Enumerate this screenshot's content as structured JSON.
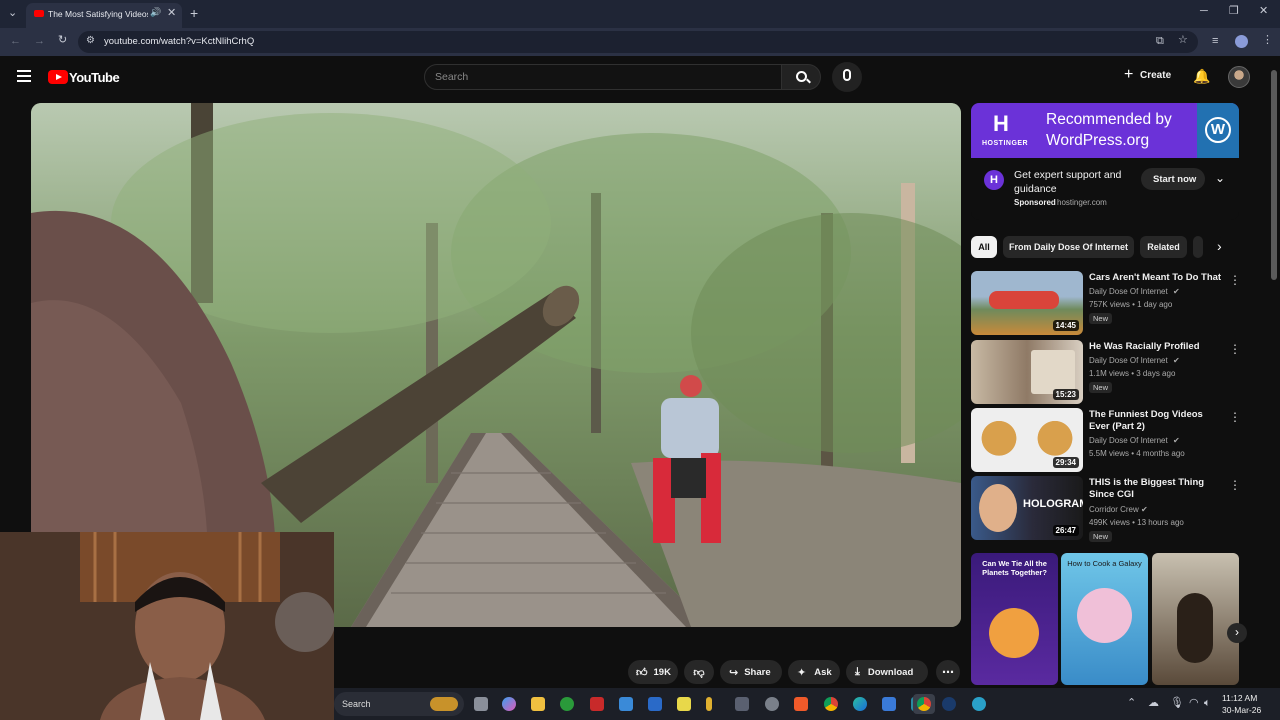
{
  "browser": {
    "tab_title": "The Most Satisfying Videos",
    "url": "youtube.com/watch?v=KctNlihCrhQ"
  },
  "youtube": {
    "logo_text": "YouTube",
    "search_placeholder": "Search",
    "create_label": "Create"
  },
  "actions": {
    "likes": "19K",
    "share": "Share",
    "ask": "Ask",
    "download": "Download"
  },
  "ad": {
    "headline": "Recommended by WordPress.org",
    "brand": "HOSTINGER",
    "text": "Get expert support and guidance",
    "sponsored": "Sponsored",
    "domain": "hostinger.com",
    "cta": "Start now"
  },
  "chips": [
    "All",
    "From Daily Dose Of Internet",
    "Related"
  ],
  "recommendations": [
    {
      "title": "Cars Aren't Meant To Do That",
      "channel": "Daily Dose Of Internet",
      "meta": "757K views • 1 day ago",
      "badge": "New",
      "duration": "14:45"
    },
    {
      "title": "He Was Racially Profiled",
      "channel": "Daily Dose Of Internet",
      "meta": "1.1M views • 3 days ago",
      "badge": "New",
      "duration": "15:23"
    },
    {
      "title": "The Funniest Dog Videos Ever (Part 2)",
      "channel": "Daily Dose Of Internet",
      "meta": "5.5M views • 4 months ago",
      "badge": "",
      "duration": "29:34"
    },
    {
      "title": "THIS is the Biggest Thing Since CGI",
      "channel": "Corridor Crew",
      "meta": "499K views • 13 hours ago",
      "badge": "New",
      "duration": "26:47"
    }
  ],
  "shorts": [
    {
      "caption": "Can We Tie All the Planets Together?"
    },
    {
      "caption": "How to Cook a Galaxy"
    },
    {
      "caption": ""
    }
  ],
  "taskbar": {
    "search": "Search",
    "time": "11:12 AM",
    "date": "30-Mar-26"
  },
  "colors": {
    "yt_red": "#ff0000",
    "ad_purple": "#6b32d8",
    "wp_blue": "#2271b1",
    "dark_bg": "#0f0f0f"
  }
}
